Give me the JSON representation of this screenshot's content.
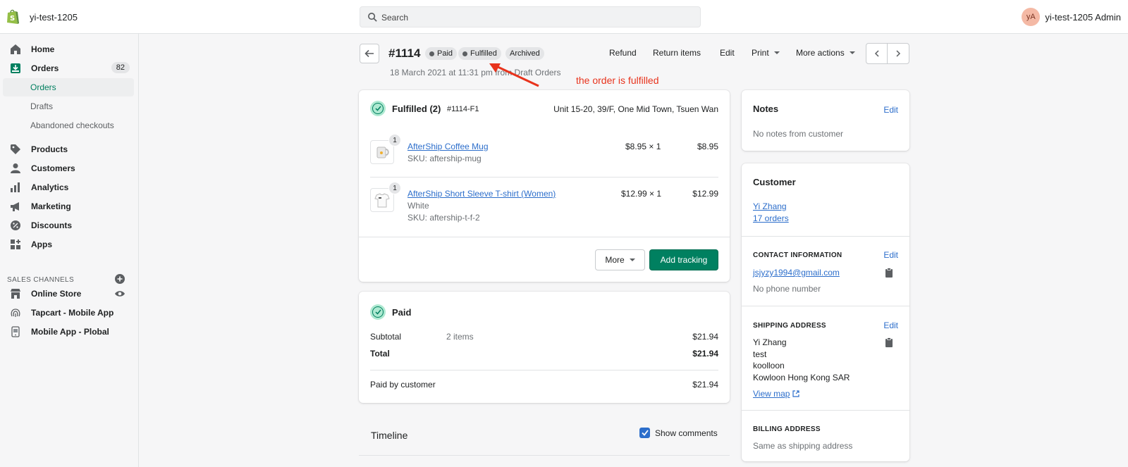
{
  "topbar": {
    "shop_name": "yi-test-1205",
    "search_placeholder": "Search",
    "avatar_initials": "yA",
    "user_name": "yi-test-1205 Admin"
  },
  "sidebar": {
    "home": "Home",
    "orders": "Orders",
    "orders_count": "82",
    "orders_sub": [
      "Orders",
      "Drafts",
      "Abandoned checkouts"
    ],
    "products": "Products",
    "customers": "Customers",
    "analytics": "Analytics",
    "marketing": "Marketing",
    "discounts": "Discounts",
    "apps": "Apps",
    "sales_channels_title": "SALES CHANNELS",
    "channels": [
      "Online Store",
      "Tapcart - Mobile App",
      "Mobile App - Plobal"
    ]
  },
  "order": {
    "number": "#1114",
    "badges": [
      "Paid",
      "Fulfilled",
      "Archived"
    ],
    "date": "18 March 2021 at 11:31 pm from Draft Orders",
    "actions": {
      "refund": "Refund",
      "return_items": "Return items",
      "edit": "Edit",
      "print": "Print",
      "more_actions": "More actions"
    }
  },
  "annotation": "the order is fulfilled",
  "fulfilled_card": {
    "title": "Fulfilled (2)",
    "fulfillment_id": "#1114-F1",
    "location": "Unit 15-20, 39/F, One Mid Town, Tsuen Wan",
    "items": [
      {
        "qty": "1",
        "name": "AfterShip Coffee Mug",
        "variant": "",
        "sku": "SKU: aftership-mug",
        "price": "$8.95 × 1",
        "total": "$8.95"
      },
      {
        "qty": "1",
        "name": "AfterShip Short Sleeve T-shirt (Women)",
        "variant": "White",
        "sku": "SKU: aftership-t-f-2",
        "price": "$12.99 × 1",
        "total": "$12.99"
      }
    ],
    "more_button": "More",
    "add_tracking_button": "Add tracking"
  },
  "paid_card": {
    "title": "Paid",
    "subtotal_label": "Subtotal",
    "subtotal_items": "2 items",
    "subtotal_value": "$21.94",
    "total_label": "Total",
    "total_value": "$21.94",
    "paid_by_label": "Paid by customer",
    "paid_by_value": "$21.94"
  },
  "timeline": {
    "title": "Timeline",
    "show_comments": "Show comments",
    "show_comments_checked": true
  },
  "notes_card": {
    "title": "Notes",
    "edit": "Edit",
    "text": "No notes from customer"
  },
  "customer_card": {
    "title": "Customer",
    "name": "Yi Zhang",
    "orders": "17 orders",
    "contact_title": "CONTACT INFORMATION",
    "contact_edit": "Edit",
    "email": "jsjyzy1994@gmail.com",
    "phone": "No phone number",
    "shipping_title": "SHIPPING ADDRESS",
    "shipping_edit": "Edit",
    "shipping_lines": [
      "Yi Zhang",
      "test",
      "koolloon",
      "Kowloon Hong Kong SAR"
    ],
    "view_map": "View map",
    "billing_title": "BILLING ADDRESS",
    "billing_text": "Same as shipping address"
  },
  "colors": {
    "accent": "#008060",
    "link": "#2c6ecb",
    "annotation": "#e8331c"
  }
}
